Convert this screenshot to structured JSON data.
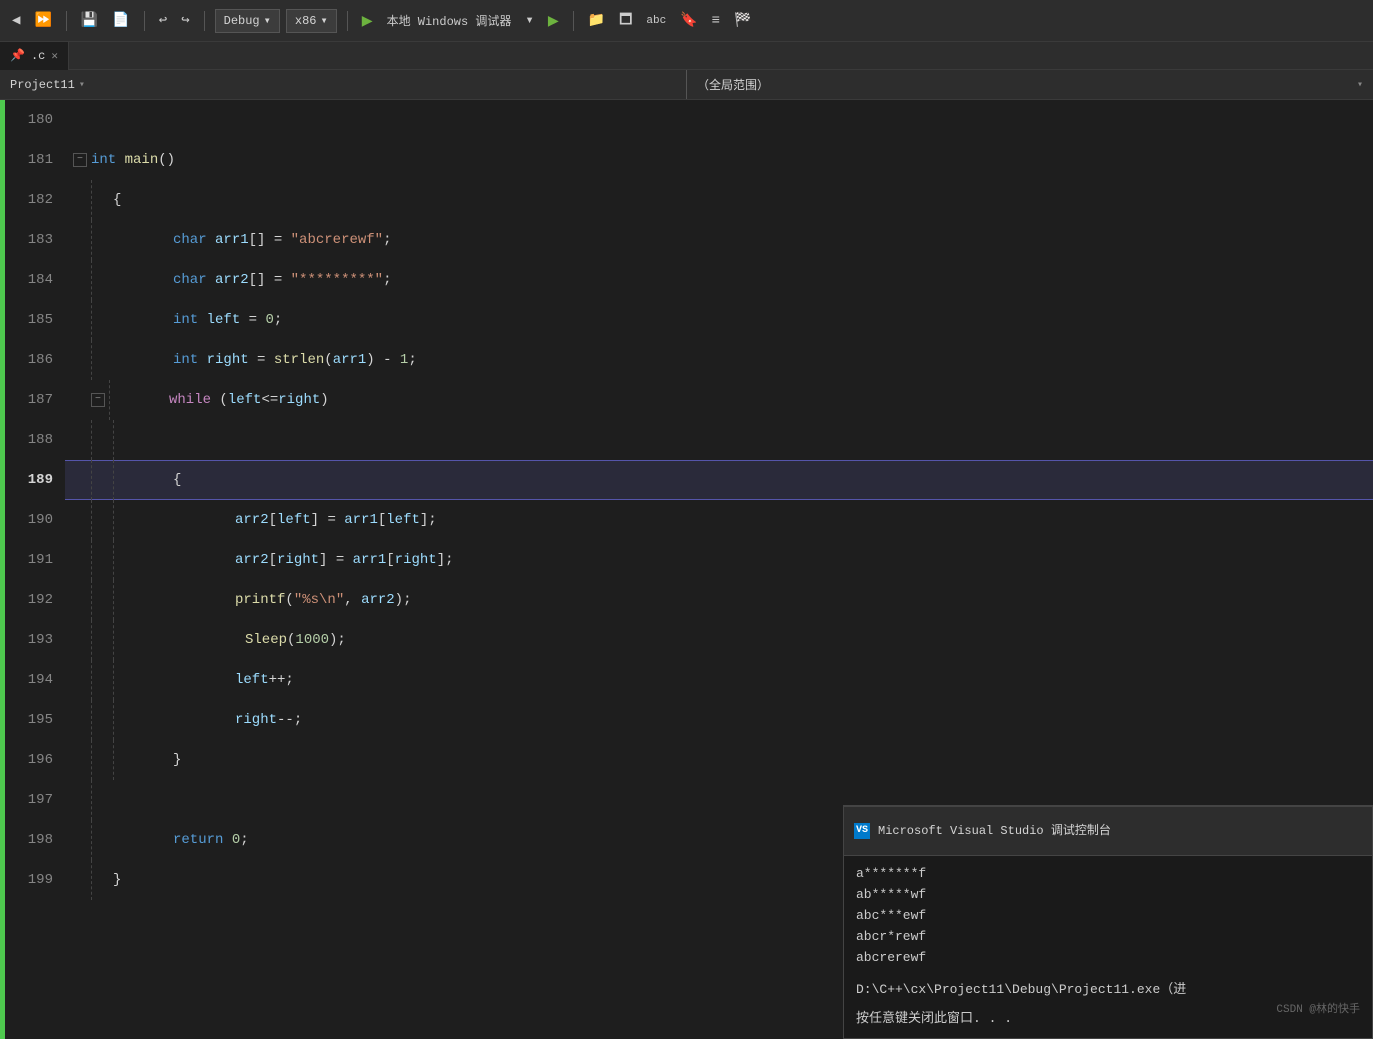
{
  "toolbar": {
    "debug_config": "Debug",
    "arch_config": "x86",
    "run_label": "本地 Windows 调试器",
    "icons": [
      "↩",
      "↪",
      "▶",
      "⏹",
      "⏸",
      "▶▶",
      "⬛"
    ]
  },
  "tabs": [
    {
      "label": ".c",
      "pinned": true,
      "active": true
    }
  ],
  "nav": {
    "left": "Project11",
    "right": "（全局范围）"
  },
  "line_numbers": [
    180,
    181,
    182,
    183,
    184,
    185,
    186,
    187,
    188,
    189,
    190,
    191,
    192,
    193,
    194,
    195,
    196,
    197,
    198,
    199
  ],
  "code_lines": [
    {
      "num": 180,
      "content": ""
    },
    {
      "num": 181,
      "content": "int_main_open",
      "collapse": true
    },
    {
      "num": 182,
      "content": "brace_open"
    },
    {
      "num": 183,
      "content": "char_arr1"
    },
    {
      "num": 184,
      "content": "char_arr2"
    },
    {
      "num": 185,
      "content": "int_left"
    },
    {
      "num": 186,
      "content": "int_right"
    },
    {
      "num": 187,
      "content": "while_stmt",
      "collapse": true
    },
    {
      "num": 188,
      "content": "empty"
    },
    {
      "num": 189,
      "content": "brace_while_open",
      "current": true
    },
    {
      "num": 190,
      "content": "arr2_left_assign"
    },
    {
      "num": 191,
      "content": "arr2_right_assign"
    },
    {
      "num": 192,
      "content": "printf_stmt"
    },
    {
      "num": 193,
      "content": "sleep_stmt"
    },
    {
      "num": 194,
      "content": "left_inc"
    },
    {
      "num": 195,
      "content": "right_dec"
    },
    {
      "num": 196,
      "content": "brace_while_close"
    },
    {
      "num": 197,
      "content": "empty"
    },
    {
      "num": 198,
      "content": "return_stmt"
    },
    {
      "num": 199,
      "content": "brace_main_close"
    }
  ],
  "debug_console": {
    "title": "Microsoft Visual Studio 调试控制台",
    "lines": [
      "a*******f",
      "ab*****wf",
      "abc***ewf",
      "abcr*rewf",
      "abcrerewf"
    ],
    "note1": "D:\\C++\\cx\\Project11\\Debug\\Project11.exe（进",
    "note2": "按任意键关闭此窗口. . ."
  },
  "watermark": "CSDN @林的快手"
}
